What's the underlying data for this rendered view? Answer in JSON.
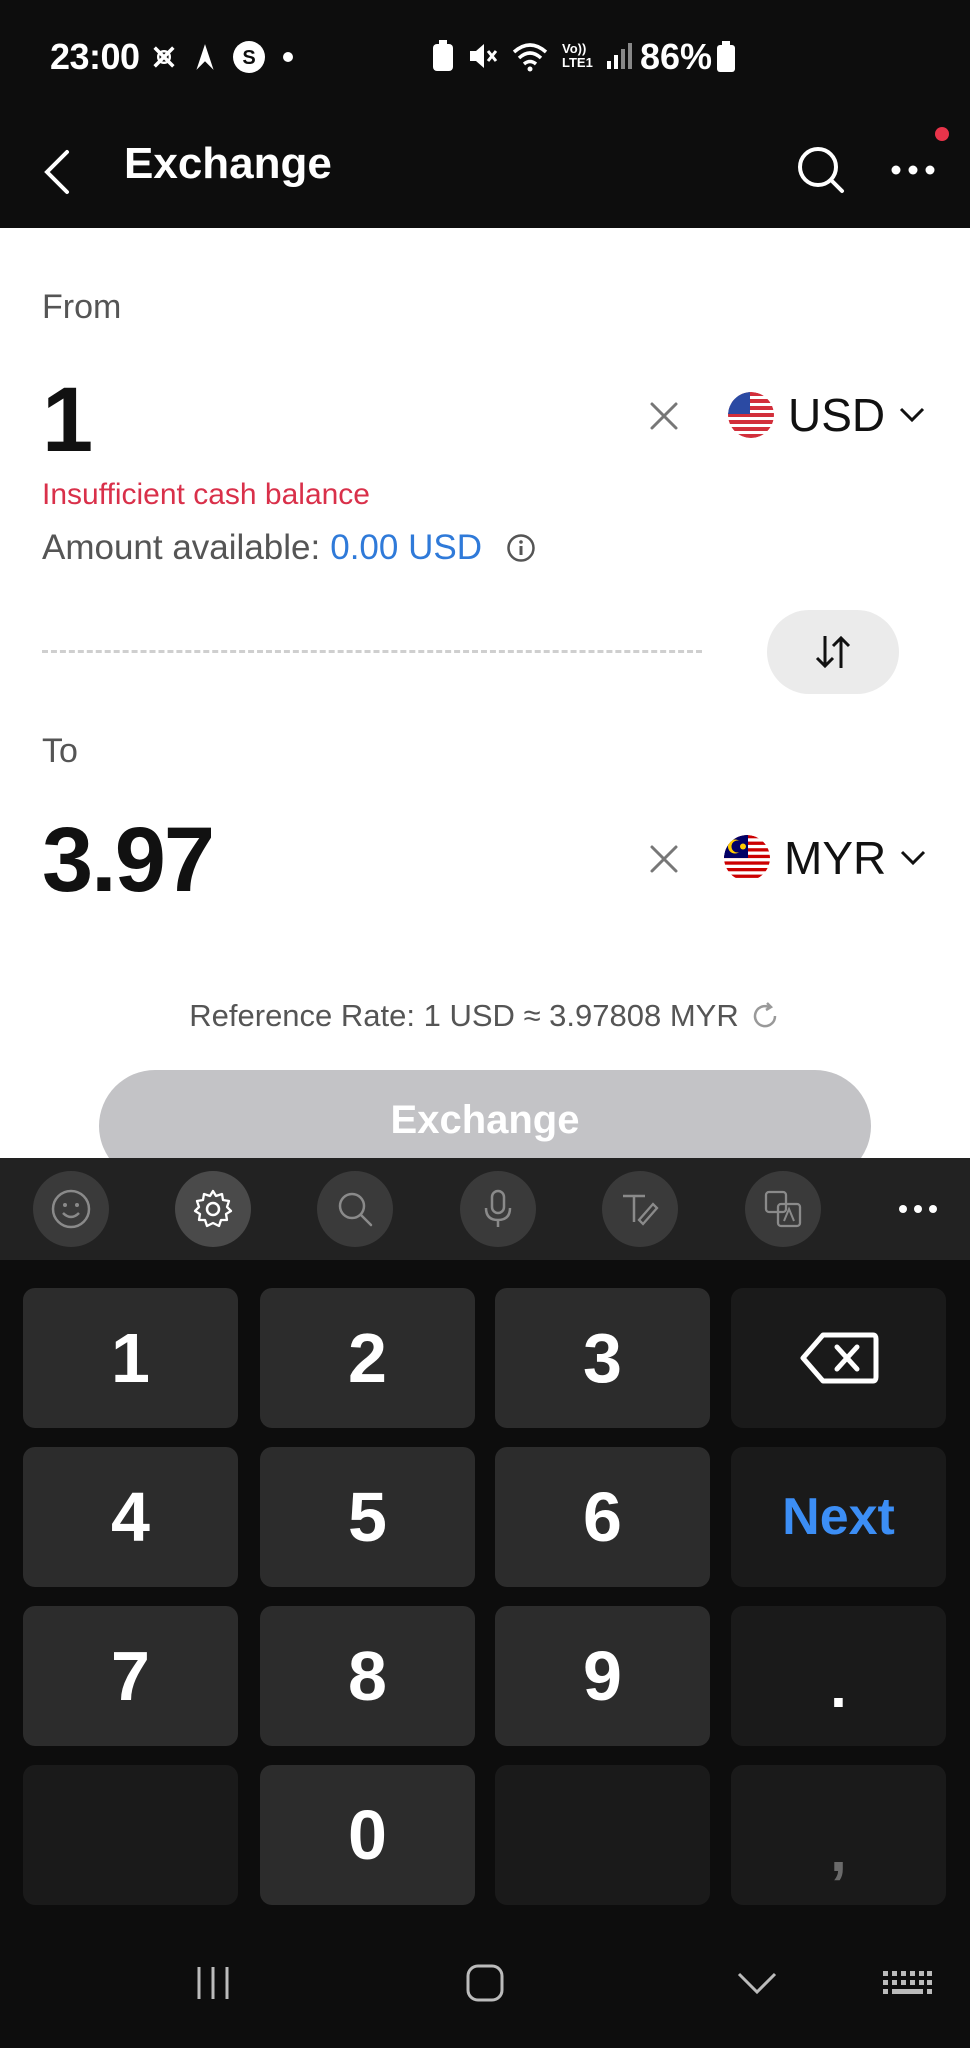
{
  "status_bar": {
    "time": "23:00",
    "battery": "86%",
    "icons": [
      "flight-icon",
      "arrow-icon",
      "s-app-icon",
      "dot-icon",
      "battery-saver-icon",
      "mute-icon",
      "wifi-icon",
      "volte-icon",
      "signal-icon",
      "battery-icon"
    ],
    "volte_label_1": "Vo))",
    "volte_label_2": "LTE1"
  },
  "header": {
    "title": "Exchange"
  },
  "from": {
    "label": "From",
    "amount": "1",
    "currency": "USD",
    "error": "Insufficient cash balance",
    "available_label": "Amount available:",
    "available_value": "0.00 USD"
  },
  "to": {
    "label": "To",
    "amount": "3.97",
    "currency": "MYR"
  },
  "reference_rate": "Reference Rate: 1 USD ≈ 3.97808 MYR",
  "exchange_button": "Exchange",
  "keyboard": {
    "toolbar": [
      "emoji-icon",
      "settings-icon",
      "search-icon",
      "mic-icon",
      "handwriting-icon",
      "translate-icon",
      "more-icon"
    ],
    "keys": [
      {
        "label": "1"
      },
      {
        "label": "2"
      },
      {
        "label": "3"
      },
      {
        "label": "backspace"
      },
      {
        "label": "4"
      },
      {
        "label": "5"
      },
      {
        "label": "6"
      },
      {
        "label": "Next"
      },
      {
        "label": "7"
      },
      {
        "label": "8"
      },
      {
        "label": "9"
      },
      {
        "label": "."
      },
      {
        "label": ""
      },
      {
        "label": "0"
      },
      {
        "label": ""
      },
      {
        "label": ","
      }
    ]
  },
  "colors": {
    "error": "#d9304a",
    "link": "#2f7ad9",
    "next_key": "#3c8ef5",
    "button_disabled": "#c3c3c6"
  }
}
